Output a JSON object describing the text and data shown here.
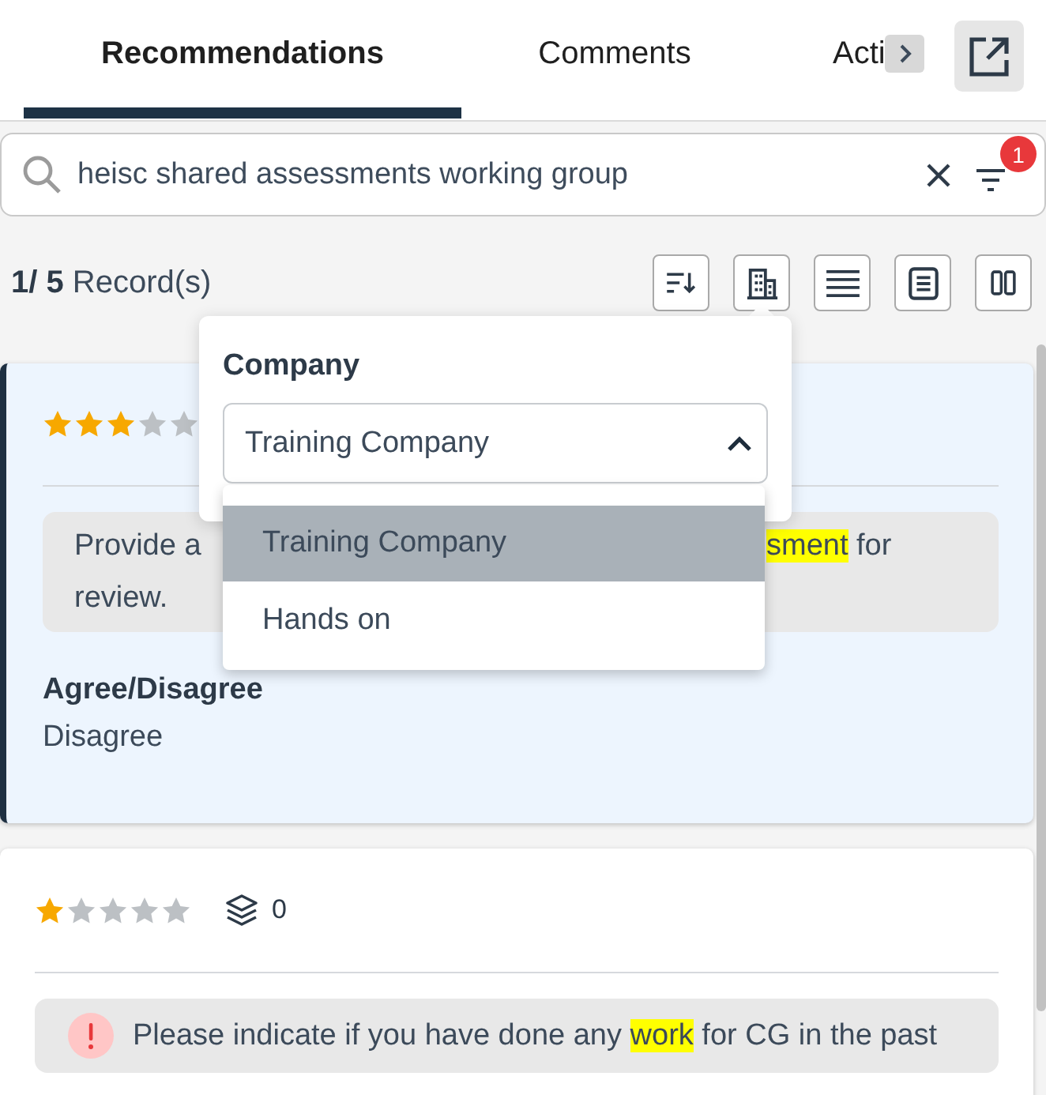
{
  "tabs": [
    {
      "label": "Recommendations",
      "selected": true
    },
    {
      "label": "Comments",
      "selected": false
    },
    {
      "label": "Acti",
      "selected": false
    }
  ],
  "search": {
    "value": "heisc shared assessments working group",
    "filter_count": "1"
  },
  "records": {
    "count": "**1/ 5** Record(s)"
  },
  "toolbar": [
    {
      "kind": "sort"
    },
    {
      "kind": "company"
    },
    {
      "kind": "list"
    },
    {
      "kind": "document"
    },
    {
      "kind": "columns"
    }
  ],
  "company_filter": {
    "label": "Company",
    "value": "Training Company",
    "expanded": true,
    "options": [
      {
        "label": "Training Company",
        "selected": true
      },
      {
        "label": "Hands on",
        "selected": false
      }
    ]
  },
  "cards": [
    {
      "selected": true,
      "stars": 3,
      "alert": false,
      "question_fragments": [
        "Provide a",
        "**sment** for",
        "review."
      ],
      "answer_label": "Agree/Disagree",
      "answer": "Disagree"
    },
    {
      "selected": false,
      "stars": 1,
      "attachments": "0",
      "alert": true,
      "question": "Please indicate if you have done any **work** for CG in the past"
    }
  ]
}
